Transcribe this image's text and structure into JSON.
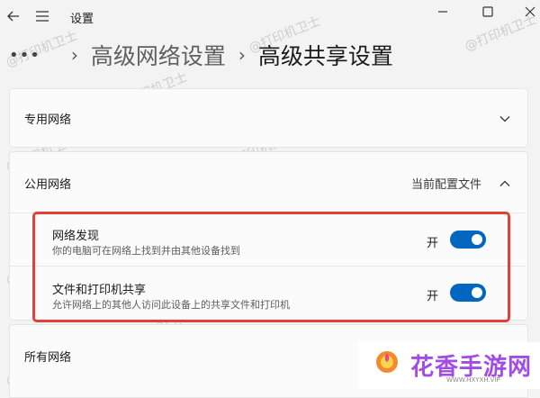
{
  "window": {
    "title": "设置"
  },
  "breadcrumb": {
    "dots": "•••",
    "parent": "高级网络设置",
    "current": "高级共享设置",
    "sep": "›"
  },
  "sections": {
    "private": {
      "label": "专用网络"
    },
    "public": {
      "label": "公用网络",
      "tag": "当前配置文件"
    },
    "all": {
      "label": "所有网络"
    }
  },
  "settings": [
    {
      "title": "网络发现",
      "desc": "你的电脑可在网络上找到并由其他设备找到",
      "state_label": "开",
      "on": true
    },
    {
      "title": "文件和打印机共享",
      "desc": "允许网络上的其他人访问此设备上的共享文件和打印机",
      "state_label": "开",
      "on": true
    }
  ],
  "watermark": {
    "text": "@打印机卫士"
  },
  "brand": {
    "name": "花香手游网",
    "url": "WWW.HXYXH.VIP"
  },
  "colors": {
    "accent": "#0067c0",
    "highlight": "#e3403a",
    "brand": "#a24ce6"
  },
  "icons": [
    "back-arrow-icon",
    "hamburger-menu-icon",
    "minimize-icon",
    "maximize-icon",
    "close-icon",
    "chevron-down-icon",
    "chevron-up-icon"
  ]
}
